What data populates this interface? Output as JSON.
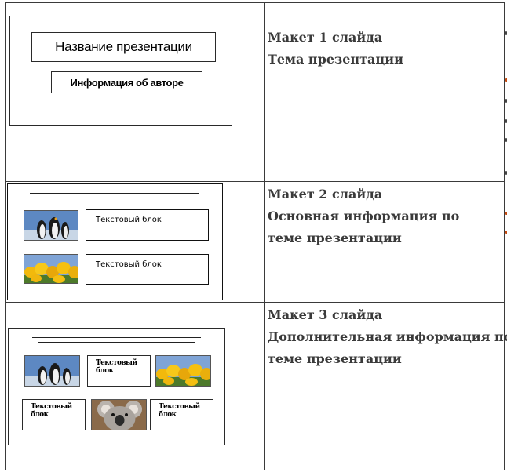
{
  "rows": [
    {
      "description": [
        "Макет 1 слайда",
        "Тема презентации"
      ],
      "slide": {
        "title_box": "Название презентации",
        "author_box": "Информация  об авторе"
      }
    },
    {
      "description": [
        "Макет 2 слайда",
        "Основная информация по",
        "теме презентации"
      ],
      "slide": {
        "text_block_1": "Текстовый блок",
        "text_block_2": "Текстовый блок",
        "image_1": "penguins-image",
        "image_2": "tulips-image"
      }
    },
    {
      "description": [
        "Макет 3 слайда",
        "Дополнительная информация по",
        "теме презентации"
      ],
      "slide": {
        "text_block_1": "Текстовый блок",
        "text_block_2": "Текстовый блок",
        "text_block_3": "Текстовый блок",
        "image_1": "penguins-image",
        "image_2": "tulips-image",
        "image_3": "koala-image"
      }
    }
  ],
  "colors": {
    "border": "#3a3a3a",
    "text": "#3a3a3a",
    "accent_fragment": "#c44a10"
  }
}
